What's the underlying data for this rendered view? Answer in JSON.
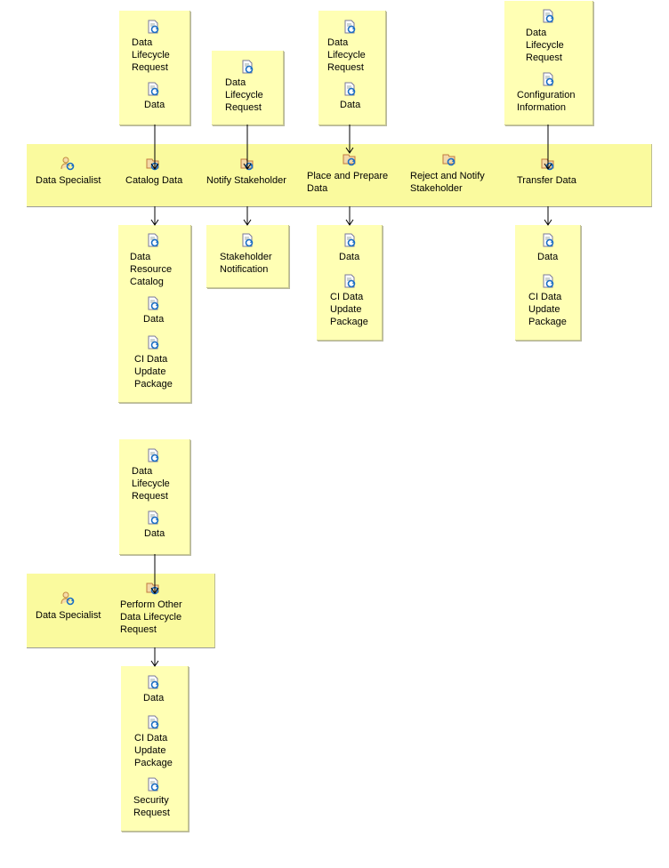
{
  "colors": {
    "box_fill": "#ffffb4",
    "band_fill": "#fafa9e",
    "arrow": "#000000"
  },
  "top_lane": {
    "role": {
      "label": "Data Specialist",
      "icon": "role-icon"
    },
    "activities": [
      {
        "label": "Catalog Data",
        "icon": "activity-icon",
        "inputs": [
          "Data Lifecycle Request",
          "Data"
        ],
        "outputs": [
          "Data Resource Catalog",
          "Data",
          "CI Data Update Package"
        ]
      },
      {
        "label": "Notify Stakeholder",
        "icon": "activity-icon",
        "inputs": [
          "Data Lifecycle Request"
        ],
        "outputs": [
          "Stakeholder Notification"
        ]
      },
      {
        "label": "Place and Prepare Data",
        "icon": "activity-icon",
        "inputs": [
          "Data Lifecycle Request",
          "Data"
        ],
        "outputs": [
          "Data",
          "CI Data Update Package"
        ]
      },
      {
        "label": "Reject and Notify Stakeholder",
        "icon": "activity-icon",
        "inputs": [],
        "outputs": []
      },
      {
        "label": "Transfer Data",
        "icon": "activity-icon",
        "inputs": [
          "Data Lifecycle Request",
          "Configuration Information"
        ],
        "outputs": [
          "Data",
          "CI Data Update Package"
        ]
      }
    ]
  },
  "bottom_lane": {
    "role": {
      "label": "Data Specialist",
      "icon": "role-icon"
    },
    "activities": [
      {
        "label": "Perform Other Data Lifecycle Request",
        "icon": "activity-icon",
        "inputs": [
          "Data Lifecycle Request",
          "Data"
        ],
        "outputs": [
          "Data",
          "CI Data Update Package",
          "Security Request"
        ]
      }
    ]
  }
}
